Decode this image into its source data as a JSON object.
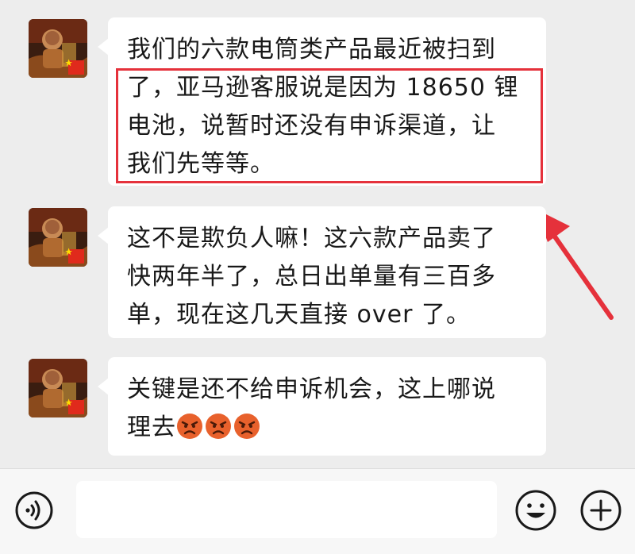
{
  "chat": {
    "messages": [
      {
        "lines": [
          "我们的六款电筒类产品最近被扫到",
          "了，亚马逊客服说是因为 18650 锂",
          "电池，说暂时还没有申诉渠道，让",
          "我们先等等。"
        ],
        "highlighted": true
      },
      {
        "lines": [
          "这不是欺负人嘛！这六款产品卖了",
          "快两年半了，总日出单量有三百多",
          "单，现在这几天直接 over 了。"
        ],
        "highlighted": false
      },
      {
        "lines": [
          "关键是还不给申诉机会，这上哪说",
          "理去"
        ],
        "trailing_emojis": [
          "angry-face-emoji",
          "angry-face-emoji",
          "angry-face-emoji"
        ],
        "highlighted": false
      }
    ]
  },
  "input_bar": {
    "voice_icon": "voice-icon",
    "emoji_icon": "smiley-icon",
    "plus_icon": "plus-circle-icon",
    "text_value": ""
  },
  "colors": {
    "background": "#ededed",
    "bubble": "#ffffff",
    "highlight": "#e5313b",
    "arrow": "#e5313b"
  }
}
